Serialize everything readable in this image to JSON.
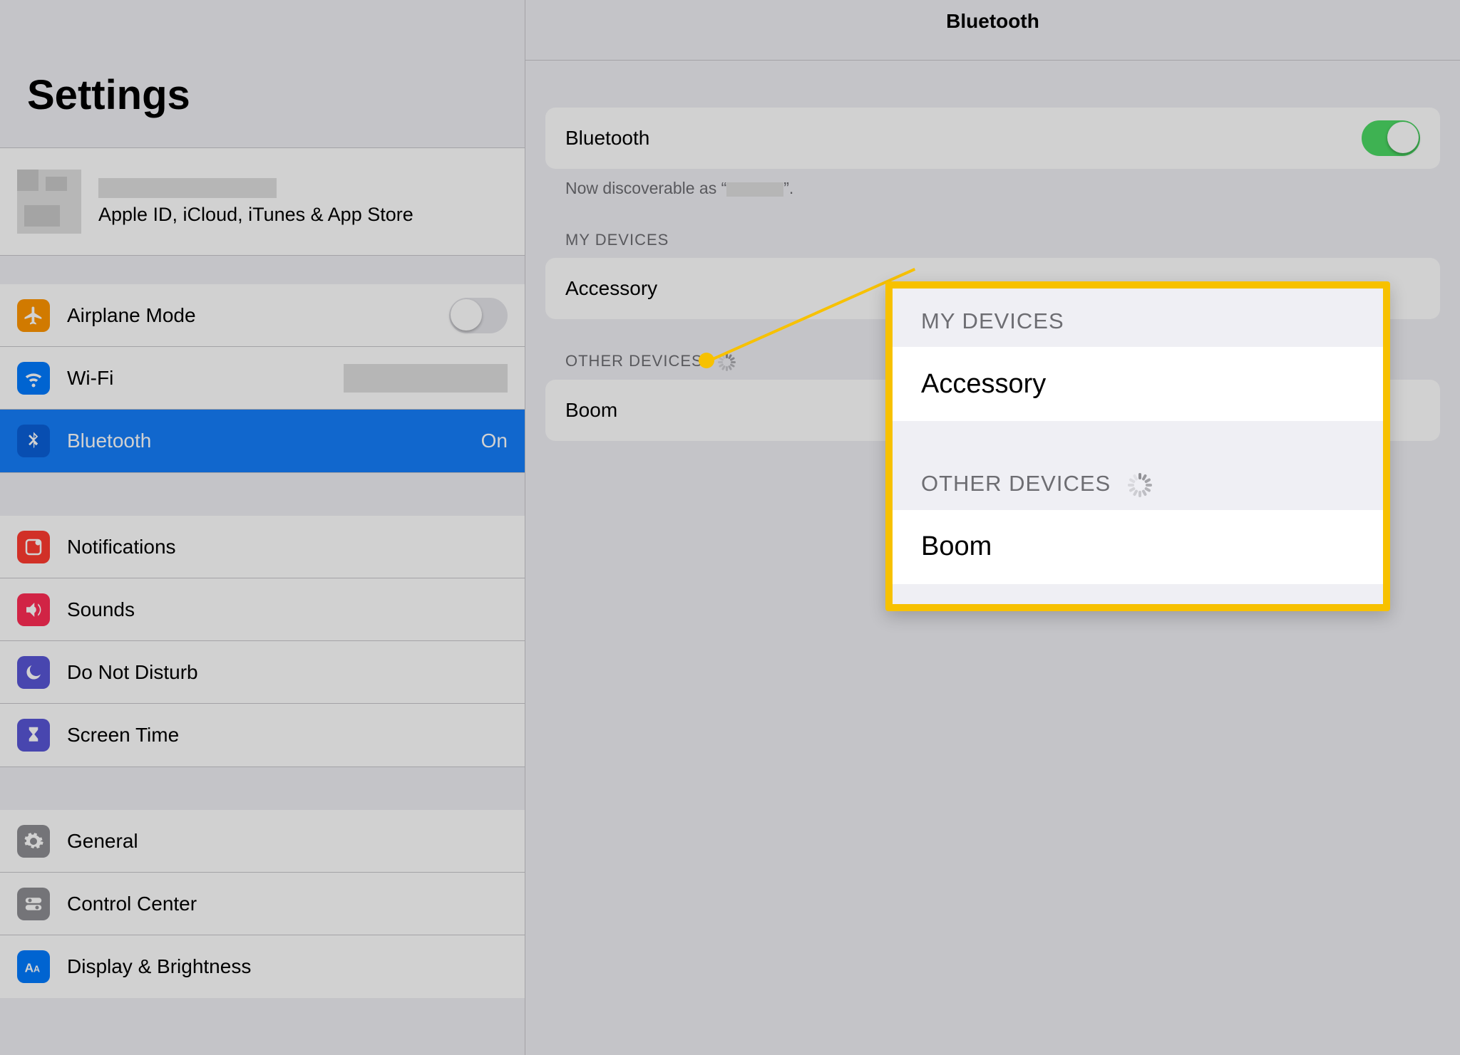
{
  "sidebar": {
    "title": "Settings",
    "account": {
      "subtitle": "Apple ID, iCloud, iTunes & App Store"
    },
    "items": {
      "airplane": {
        "label": "Airplane Mode",
        "toggle_on": false
      },
      "wifi": {
        "label": "Wi-Fi"
      },
      "bluetooth": {
        "label": "Bluetooth",
        "value": "On"
      },
      "notifications": {
        "label": "Notifications"
      },
      "sounds": {
        "label": "Sounds"
      },
      "dnd": {
        "label": "Do Not Disturb"
      },
      "screentime": {
        "label": "Screen Time"
      },
      "general": {
        "label": "General"
      },
      "controlcenter": {
        "label": "Control Center"
      },
      "display": {
        "label": "Display & Brightness"
      }
    }
  },
  "detail": {
    "title": "Bluetooth",
    "toggle_label": "Bluetooth",
    "toggle_on": true,
    "discoverable_prefix": "Now discoverable as “",
    "discoverable_suffix": "”.",
    "section_my_devices": "MY DEVICES",
    "my_devices": [
      {
        "name": "Accessory"
      }
    ],
    "section_other_devices": "OTHER DEVICES",
    "other_devices": [
      {
        "name": "Boom"
      }
    ]
  },
  "callout": {
    "section_my_devices": "MY DEVICES",
    "my_devices": [
      {
        "name": "Accessory"
      }
    ],
    "section_other_devices": "OTHER DEVICES",
    "other_devices": [
      {
        "name": "Boom"
      }
    ]
  },
  "colors": {
    "orange": "#ff9500",
    "blue": "#007aff",
    "red": "#ff3b30",
    "red2": "#ff2d55",
    "purple": "#5856d6",
    "purple2": "#5856d6",
    "gray": "#8e8e93",
    "blue2": "#007aff"
  }
}
